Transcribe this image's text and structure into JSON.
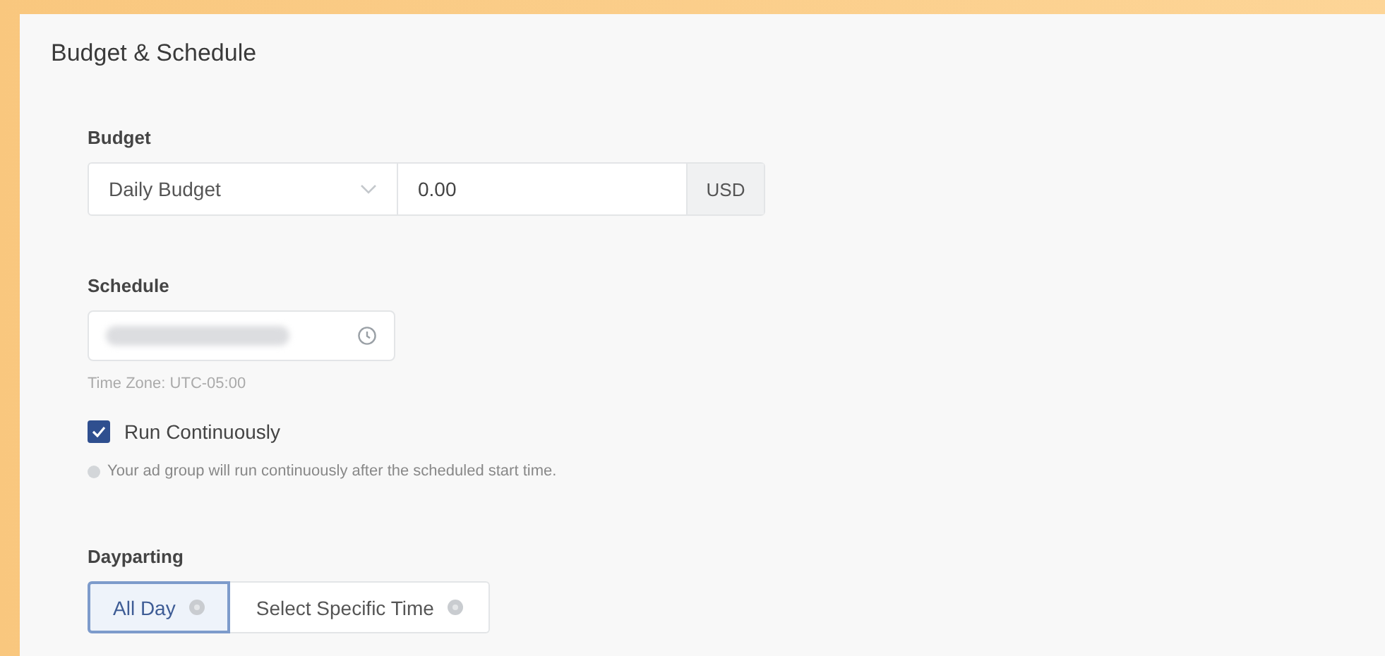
{
  "panel": {
    "title": "Budget & Schedule"
  },
  "budget": {
    "label": "Budget",
    "type_select": "Daily Budget",
    "amount": "0.00",
    "currency": "USD"
  },
  "schedule": {
    "label": "Schedule",
    "value_redacted": true,
    "time_zone": "Time Zone: UTC-05:00"
  },
  "run_continuously": {
    "label": "Run Continuously",
    "checked": true,
    "note": "Your ad group will run continuously after the scheduled start time."
  },
  "dayparting": {
    "label": "Dayparting",
    "options": [
      {
        "label": "All Day",
        "selected": true
      },
      {
        "label": "Select Specific Time",
        "selected": false
      }
    ]
  }
}
